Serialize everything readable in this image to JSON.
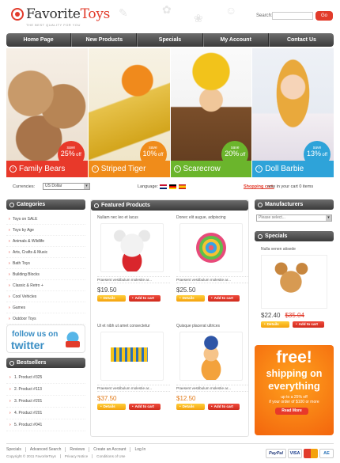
{
  "header": {
    "logo_text_a": "Favorite",
    "logo_text_b": "Toys",
    "tagline": "THE BEST QUALITY FOR YOU",
    "search_label": "Search:",
    "search_value": "",
    "search_button": "Go"
  },
  "nav": {
    "items": [
      {
        "label": "Home Page"
      },
      {
        "label": "New Products"
      },
      {
        "label": "Specials"
      },
      {
        "label": "My Account"
      },
      {
        "label": "Contact Us"
      }
    ]
  },
  "banners": [
    {
      "label": "Family Bears",
      "save": "save",
      "pct": "25%",
      "off": "off"
    },
    {
      "label": "Striped Tiger",
      "save": "save",
      "pct": "10%",
      "off": "off"
    },
    {
      "label": "Scarecrow",
      "save": "save",
      "pct": "20%",
      "off": "off"
    },
    {
      "label": "Doll Barbie",
      "save": "save",
      "pct": "13%",
      "off": "off"
    }
  ],
  "options": {
    "currency_label": "Currencies:",
    "currency_value": "US Dollar",
    "language_label": "Language:",
    "cart_link": "Shopping cart:",
    "cart_text": "now in your cart 0 items"
  },
  "categories": {
    "title": "Categories",
    "items": [
      "Toys on SALE",
      "Toys by Age",
      "Animals & Wildlife",
      "Arts, Crafts & Music",
      "Bath Toys",
      "Building Blocks",
      "Classic & Retro +",
      "Cool Vehicles",
      "Games",
      "Outdoor Toys"
    ]
  },
  "twitter": {
    "follow": "follow us on",
    "word": "twitter"
  },
  "bestsellers": {
    "title": "Bestsellers",
    "items": [
      "1.   Product #325",
      "2.   Product #113",
      "3.   Product #201",
      "4.   Product #201",
      "5.   Product #041"
    ]
  },
  "featured": {
    "title": "Featured Products",
    "details_label": "Details",
    "cart_label": "Add to cart",
    "products": [
      {
        "name": "Nullam nec leo et lacus",
        "desc": "Praesent vestibulum molestie ar...",
        "price": "$19.50"
      },
      {
        "name": "Donec elit augue, adipiscing",
        "desc": "Praesent vestibulum molestie ar...",
        "price": "$25.50"
      },
      {
        "name": "Ut et nibh ut amet consectetur",
        "desc": "Praesent vestibulum molestie ar...",
        "price": "$37.50"
      },
      {
        "name": "Quisque placerat ultrices",
        "desc": "Praesent vestibulum molestie ar...",
        "price": "$12.50"
      }
    ]
  },
  "manufacturers": {
    "title": "Manufacturers",
    "select": "Please select..."
  },
  "specials": {
    "title": "Specials",
    "name": "Nulla venen atisede",
    "new_price": "$22.40",
    "old_price": "$35.04"
  },
  "promo": {
    "free": "free!",
    "shipping": "shipping on",
    "everything": "everything",
    "small1": "up to a 25% off",
    "small2": "if your order of $100 or more",
    "button": "Read More"
  },
  "footer": {
    "links": [
      "Specials",
      "Advanced Search",
      "Reviews",
      "Create an Account",
      "Log In"
    ],
    "links2": [
      "Copyright © 2011 FavoriteToys",
      "Privacy Notice",
      "Conditions of Use"
    ],
    "pay": {
      "paypal": "PayPal",
      "visa": "VISA",
      "ae": "AE"
    }
  },
  "colors": {
    "accent": "#e23b2b",
    "nav": "#3a3a3a",
    "orange": "#f4a20d"
  }
}
